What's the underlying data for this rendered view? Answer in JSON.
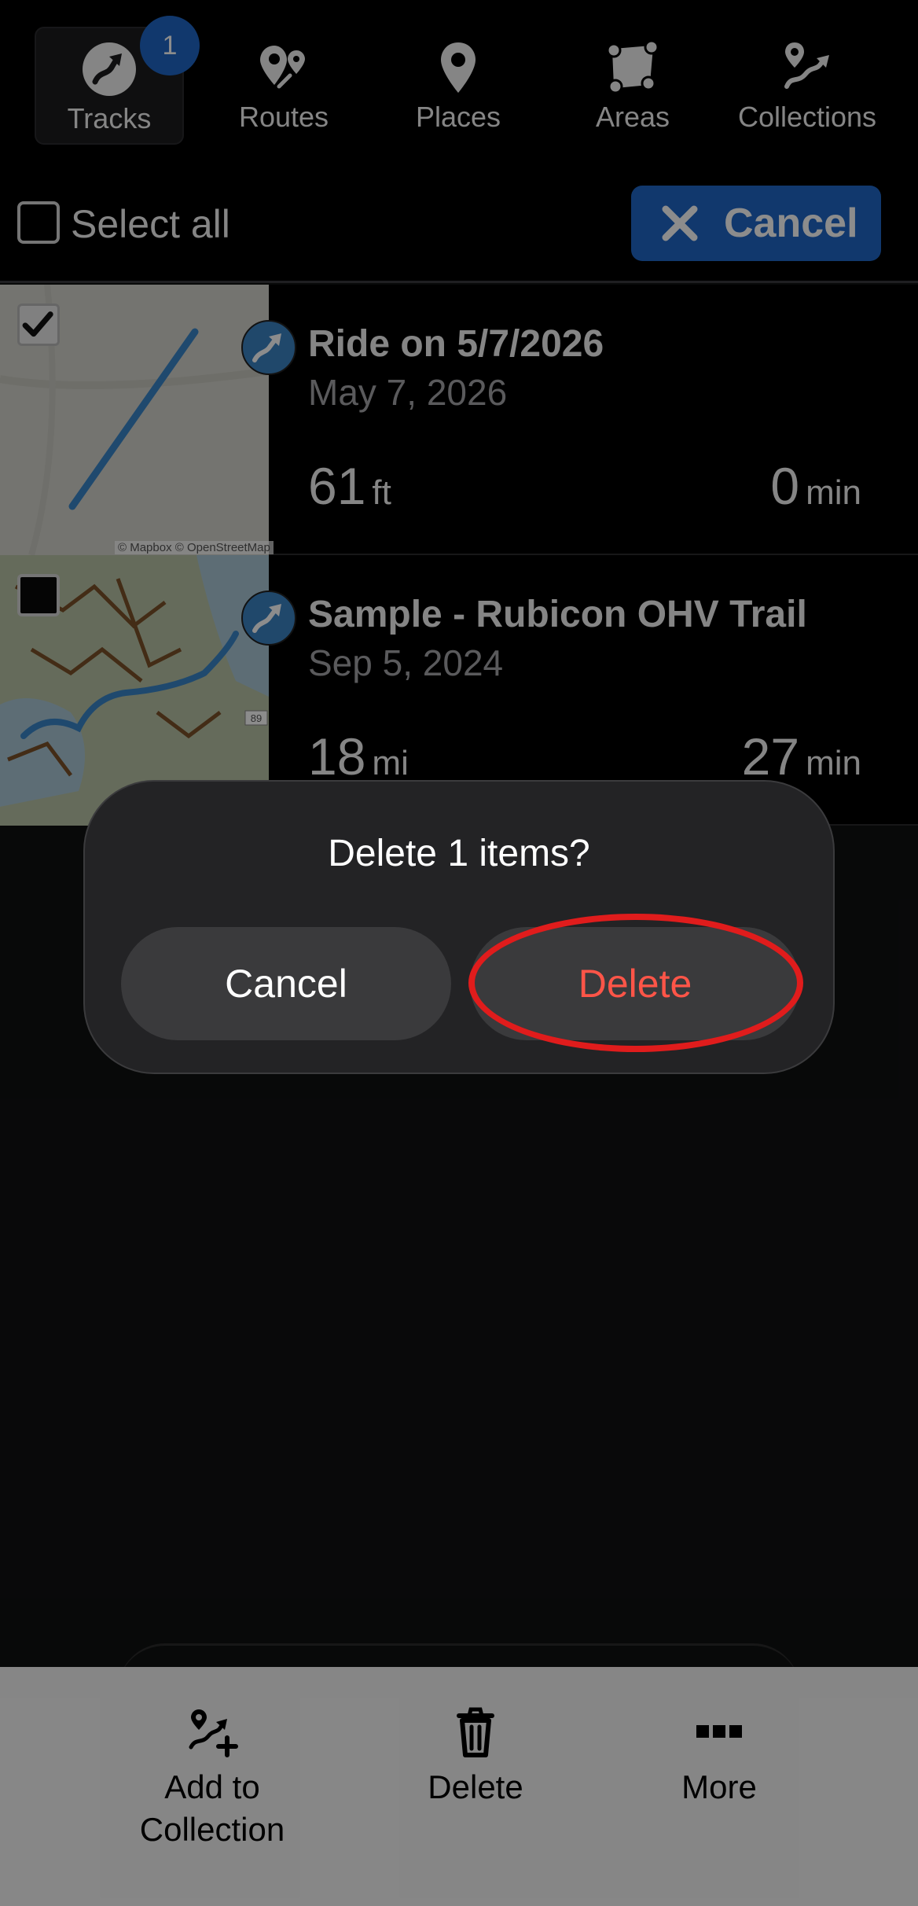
{
  "tabs": [
    {
      "label": "Tracks",
      "icon": "tracks-icon",
      "active": true,
      "badge": "1"
    },
    {
      "label": "Routes",
      "icon": "routes-icon"
    },
    {
      "label": "Places",
      "icon": "places-icon"
    },
    {
      "label": "Areas",
      "icon": "areas-icon"
    },
    {
      "label": "Collections",
      "icon": "collections-icon"
    }
  ],
  "selection": {
    "select_all_label": "Select all",
    "cancel_label": "Cancel"
  },
  "tracks": [
    {
      "title": "Ride on 5/7/2026",
      "date": "May 7, 2026",
      "distance_value": "61",
      "distance_unit": "ft",
      "duration_value": "0",
      "duration_unit": "min",
      "checked": true,
      "attribution": "© Mapbox © OpenStreetMap"
    },
    {
      "title": "Sample - Rubicon OHV Trail",
      "date": "Sep 5, 2024",
      "distance_value": "18",
      "distance_unit": "mi",
      "duration_value": "27",
      "duration_unit": "min",
      "checked": false,
      "map_label": "89"
    }
  ],
  "dialog": {
    "title": "Delete 1 items?",
    "cancel_label": "Cancel",
    "delete_label": "Delete"
  },
  "bottom_bar": {
    "add_line1": "Add to",
    "add_line2": "Collection",
    "delete_label": "Delete",
    "more_label": "More"
  },
  "colors": {
    "accent": "#1f66c6",
    "destructive": "#ff5548",
    "highlight": "#e01c1c"
  }
}
